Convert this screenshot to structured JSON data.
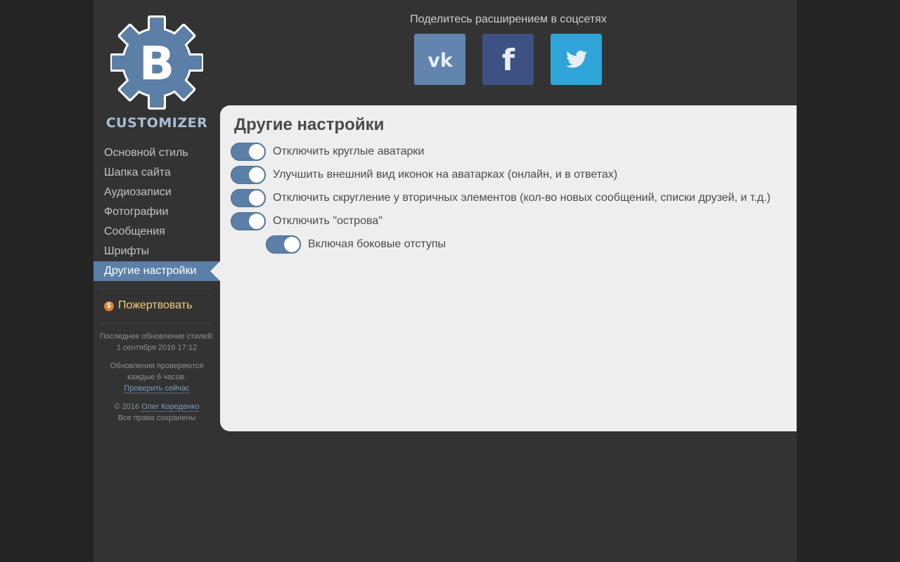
{
  "sidebar": {
    "brand": "CUSTOMIZER",
    "logo_letter": "B",
    "nav": [
      {
        "label": "Основной стиль"
      },
      {
        "label": "Шапка сайта"
      },
      {
        "label": "Аудиозаписи"
      },
      {
        "label": "Фотографии"
      },
      {
        "label": "Сообщения"
      },
      {
        "label": "Шрифты"
      },
      {
        "label": "Другие настройки",
        "active": true
      }
    ],
    "donate_label": "Пожертвовать",
    "last_update_label": "Последнее обновление стилей:",
    "last_update_value": "1 сентября 2016 17:12",
    "update_check_line1": "Обновления проверяются",
    "update_check_line2": "каждые 6 часов.",
    "check_now_link": "Проверить сейчас",
    "copyright_prefix": "© 2016",
    "author_link": "Олег Короденко",
    "rights": "Все права сохранены"
  },
  "share": {
    "title": "Поделитесь расширением в соцсетях",
    "buttons": [
      {
        "icon": "vk-icon",
        "color": "#6185ae"
      },
      {
        "icon": "facebook-icon",
        "color": "#3d5184"
      },
      {
        "icon": "twitter-icon",
        "color": "#2ea4d9"
      }
    ]
  },
  "panel": {
    "title": "Другие настройки",
    "options": [
      {
        "label": "Отключить круглые аватарки",
        "enabled": true
      },
      {
        "label": "Улучшить внешний вид иконок на аватарках (онлайн, и в ответах)",
        "enabled": true
      },
      {
        "label": "Отключить скругление у вторичных элементов (кол-во новых сообщений, списки друзей, и т.д.)",
        "enabled": true
      },
      {
        "label": "Отключить \"острова\"",
        "enabled": true
      },
      {
        "label": "Включая боковые отступы",
        "enabled": true,
        "nested": true
      }
    ]
  },
  "colors": {
    "accent": "#5b7fa6",
    "background": "#333333",
    "panel": "#eeeeee",
    "donate": "#f0cf7c"
  }
}
